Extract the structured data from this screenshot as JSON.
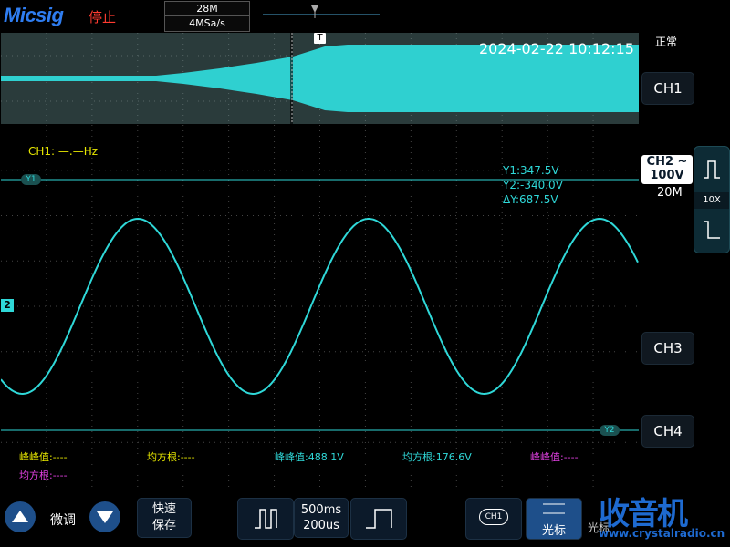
{
  "header": {
    "logo": "Micsig",
    "status": "停止",
    "memory_depth": "28M",
    "sample_rate": "4MSa/s"
  },
  "overview": {
    "datetime": "2024-02-22 10:12:15",
    "trigger_marker": "T"
  },
  "waveform": {
    "ch1_freq_label": "CH1: —.—Hz",
    "cursor1_tag": "Y1",
    "cursor2_tag": "Y2",
    "cursor_y1": "Y1:347.5V",
    "cursor_y2": "Y2:-340.0V",
    "cursor_dy": "ΔY:687.5V",
    "ch2_marker": "2"
  },
  "measurements": [
    {
      "label": "峰峰值:----",
      "color": "#e8e800"
    },
    {
      "label": "均方根:----",
      "color": "#e8e800"
    },
    {
      "label": "峰峰值:488.1V",
      "color": "#2fd8d8"
    },
    {
      "label": "均方根:176.6V",
      "color": "#2fd8d8"
    },
    {
      "label": "峰峰值:----",
      "color": "#e040e0"
    },
    {
      "label": "均方根:----",
      "color": "#e040e0"
    }
  ],
  "right_panel": {
    "mode": "正常",
    "ch1": "CH1",
    "ch2_name": "CH2",
    "ch2_coupling": "~",
    "ch2_scale": "100V",
    "ch2_bandwidth": "20M",
    "probe": "10X",
    "ch3": "CH3",
    "ch4": "CH4"
  },
  "bottom": {
    "fine_label": "微调",
    "save_line1": "快速",
    "save_line2": "保存",
    "timebase": "500ms",
    "timebase2": "200us",
    "ch1_icon": "CH1",
    "cursor_label": "光标",
    "extra_label": "光标",
    "watermark": "收音机",
    "watermark_url": "www.crystalradio.cn"
  },
  "colors": {
    "ch1": "#e8e800",
    "ch2": "#2fd8d8",
    "ch3": "#e040e0",
    "accent": "#1e4f8a"
  }
}
